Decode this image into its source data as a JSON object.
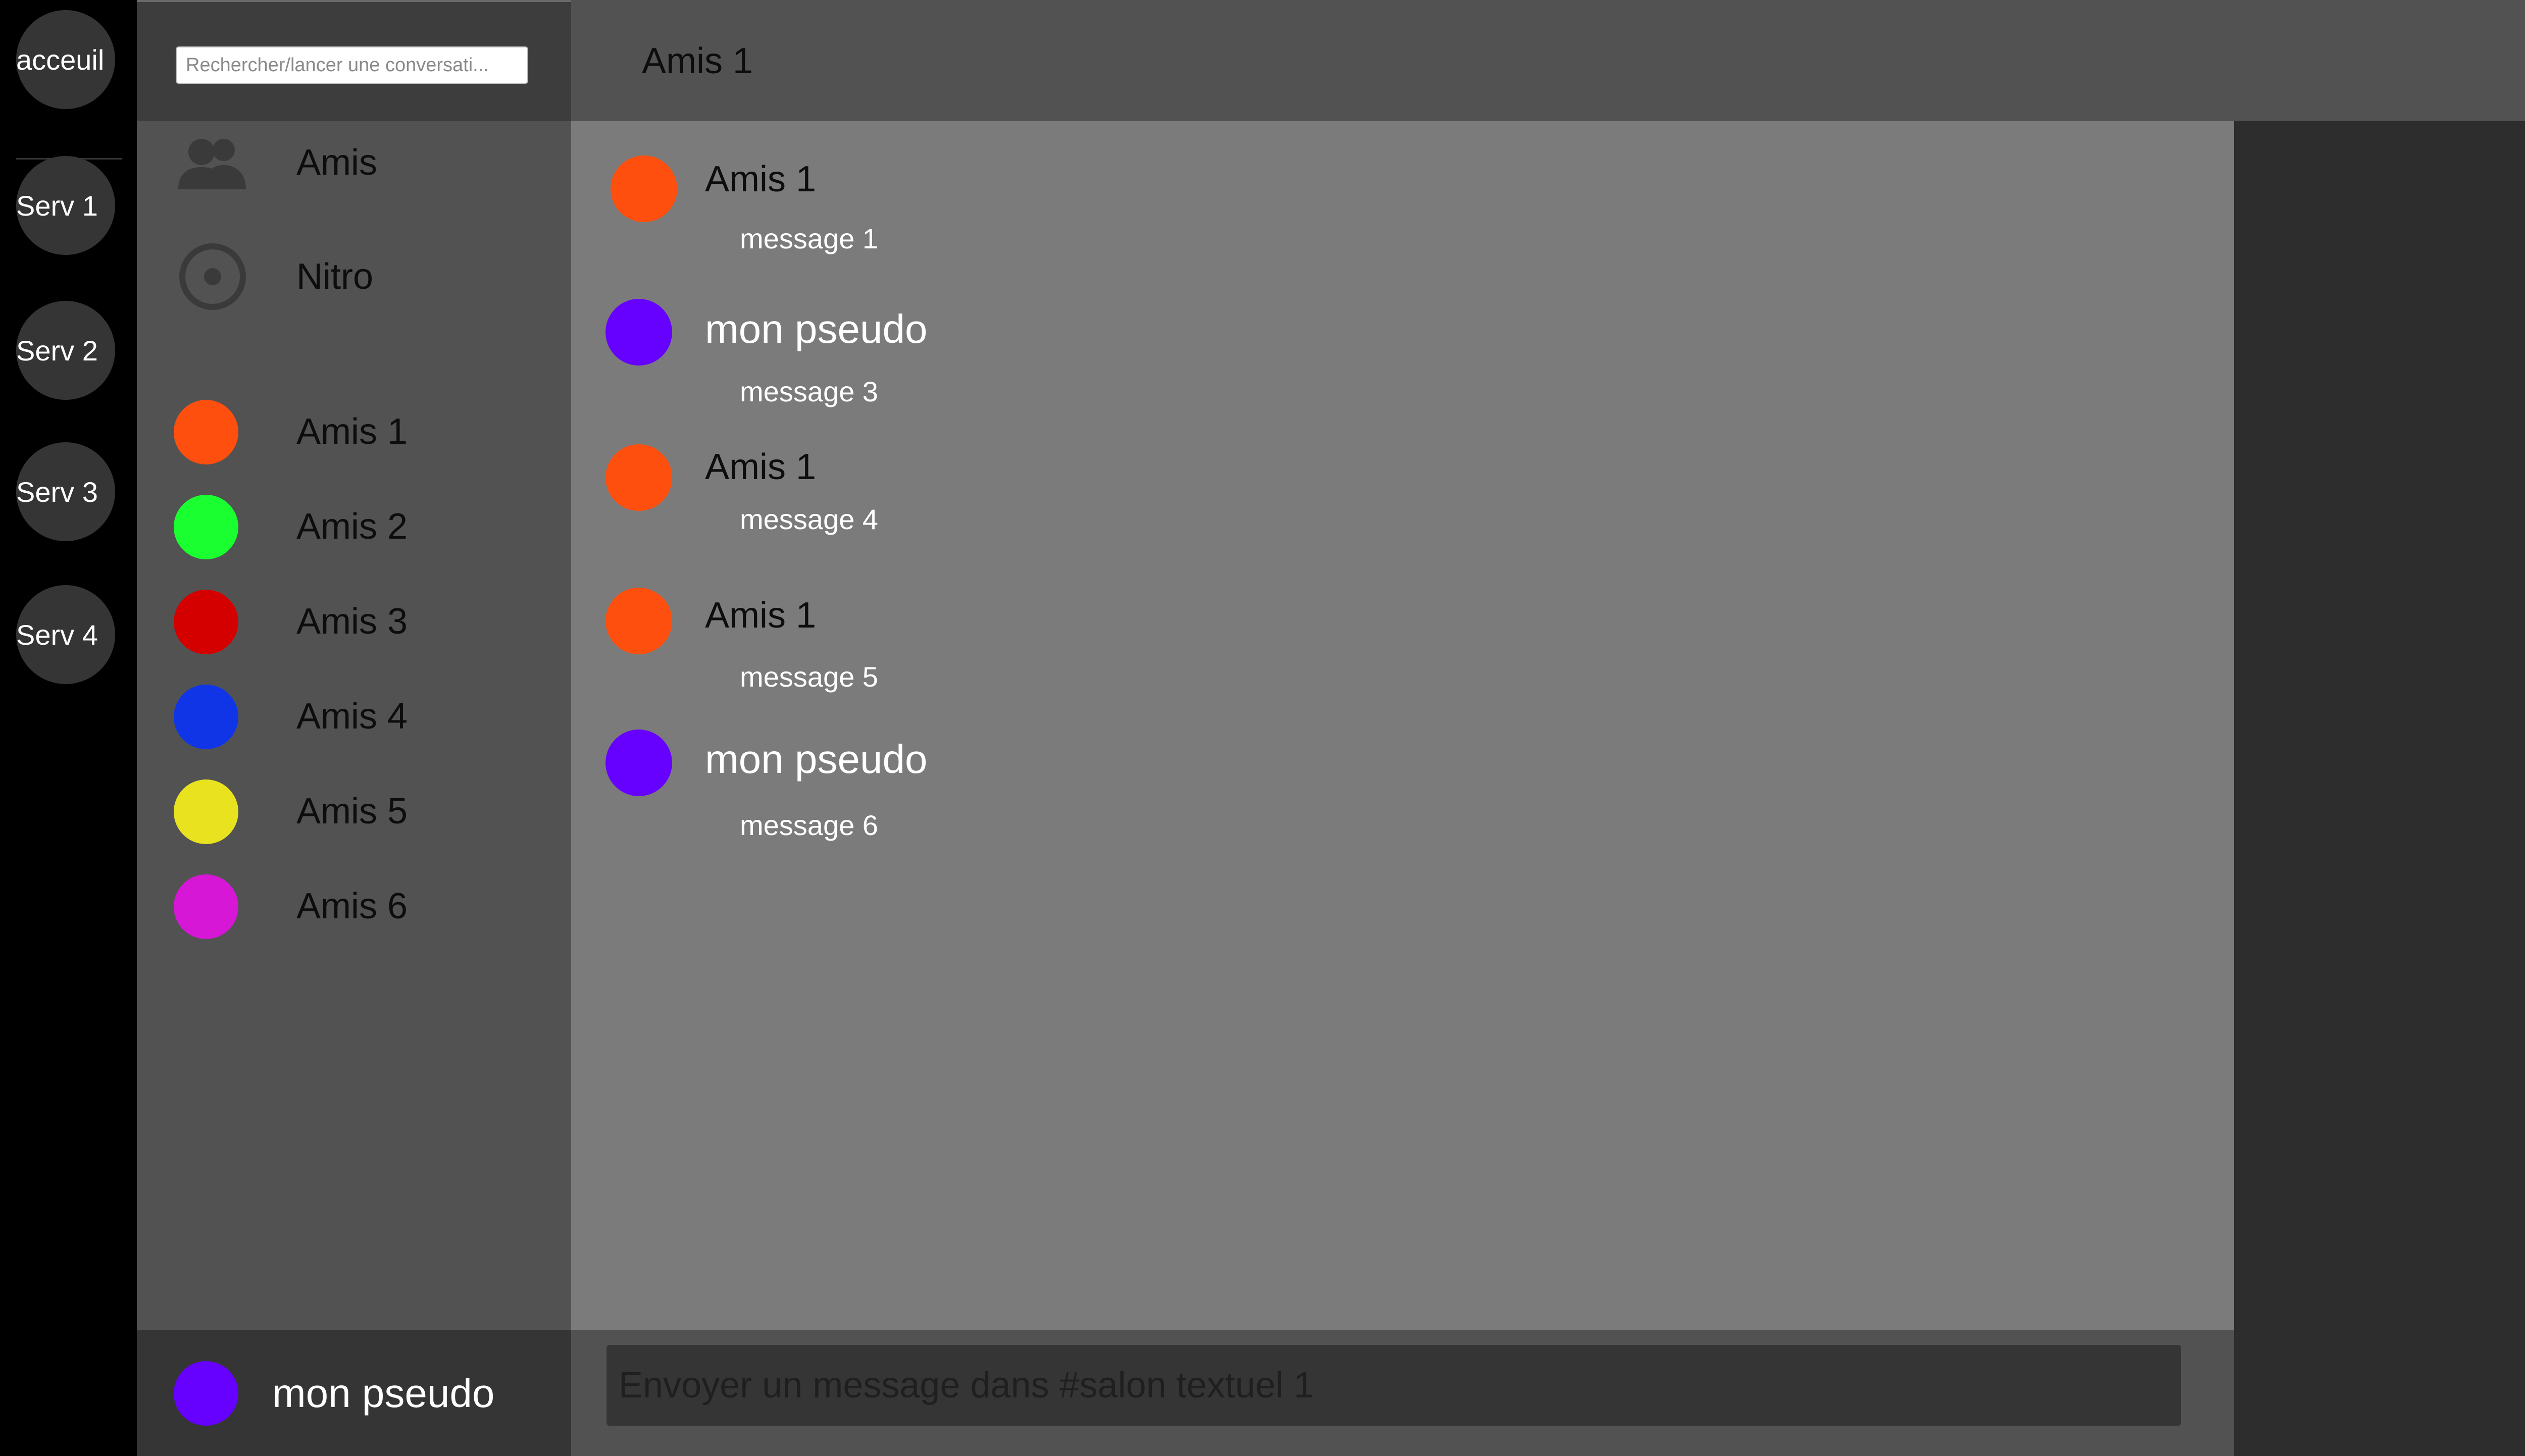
{
  "rail": {
    "home_label": "acceuil",
    "servers": [
      {
        "label": "Serv 1"
      },
      {
        "label": "Serv 2"
      },
      {
        "label": "Serv 3"
      },
      {
        "label": "Serv 4"
      }
    ],
    "button_color": "#353535"
  },
  "sidebar": {
    "search_placeholder": "Rechercher/lancer une conversati...",
    "nav": [
      {
        "label": "Amis",
        "icon": "friends-icon"
      },
      {
        "label": "Nitro",
        "icon": "nitro-icon"
      }
    ],
    "friends": [
      {
        "name": "Amis 1",
        "color": "#ff4f0f"
      },
      {
        "name": "Amis 2",
        "color": "#19ff2f"
      },
      {
        "name": "Amis 3",
        "color": "#d40000"
      },
      {
        "name": "Amis 4",
        "color": "#1035e6"
      },
      {
        "name": "Amis 5",
        "color": "#e8e21f"
      },
      {
        "name": "Amis 6",
        "color": "#d617d6"
      }
    ]
  },
  "user": {
    "name": "mon pseudo",
    "color": "#6600ff"
  },
  "conversation": {
    "title": "Amis 1",
    "messages": [
      {
        "author": "Amis 1",
        "text": "message 1",
        "color": "#ff4f0f",
        "is_self": false
      },
      {
        "author": "mon pseudo",
        "text": "message 3",
        "color": "#6600ff",
        "is_self": true
      },
      {
        "author": "Amis 1",
        "text": "message 4",
        "color": "#ff4f0f",
        "is_self": false
      },
      {
        "author": "Amis 1",
        "text": "message 5",
        "color": "#ff4f0f",
        "is_self": false
      },
      {
        "author": "mon pseudo",
        "text": "message 6",
        "color": "#6600ff",
        "is_self": true
      }
    ]
  },
  "composer": {
    "placeholder": "Envoyer un message dans #salon textuel 1"
  },
  "colors": {
    "rail_bg": "#000000",
    "sidebar_bg": "#525252",
    "chat_bg": "#7c7b7b",
    "members_bg": "#2d2d2d"
  }
}
